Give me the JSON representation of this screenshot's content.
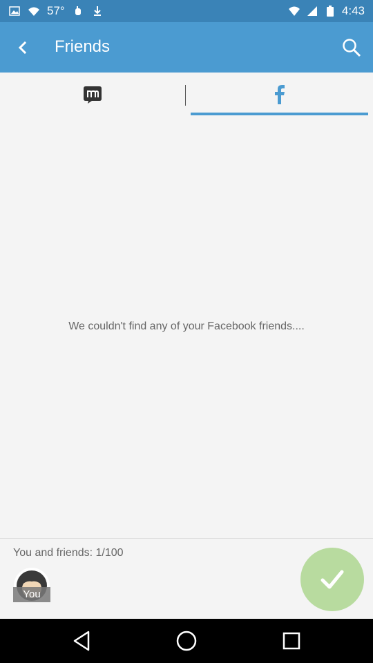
{
  "status_bar": {
    "time": "4:43",
    "temperature": "57°",
    "icons_left": [
      "image-icon",
      "wifi-lock-icon",
      "download-icon"
    ],
    "icons_right": [
      "wifi-icon",
      "signal-icon",
      "battery-icon"
    ]
  },
  "app_bar": {
    "title": "Friends",
    "color": "#4b9bd1"
  },
  "tabs": [
    {
      "icon": "messenger-m-icon",
      "selected": false
    },
    {
      "icon": "facebook-icon",
      "selected": true
    }
  ],
  "main": {
    "empty_message": "We couldn't find any of your Facebook friends...."
  },
  "bottom_panel": {
    "friends_count_label": "You and friends: 1/100",
    "avatar_label": "You",
    "confirm_color": "#b8db9f"
  }
}
